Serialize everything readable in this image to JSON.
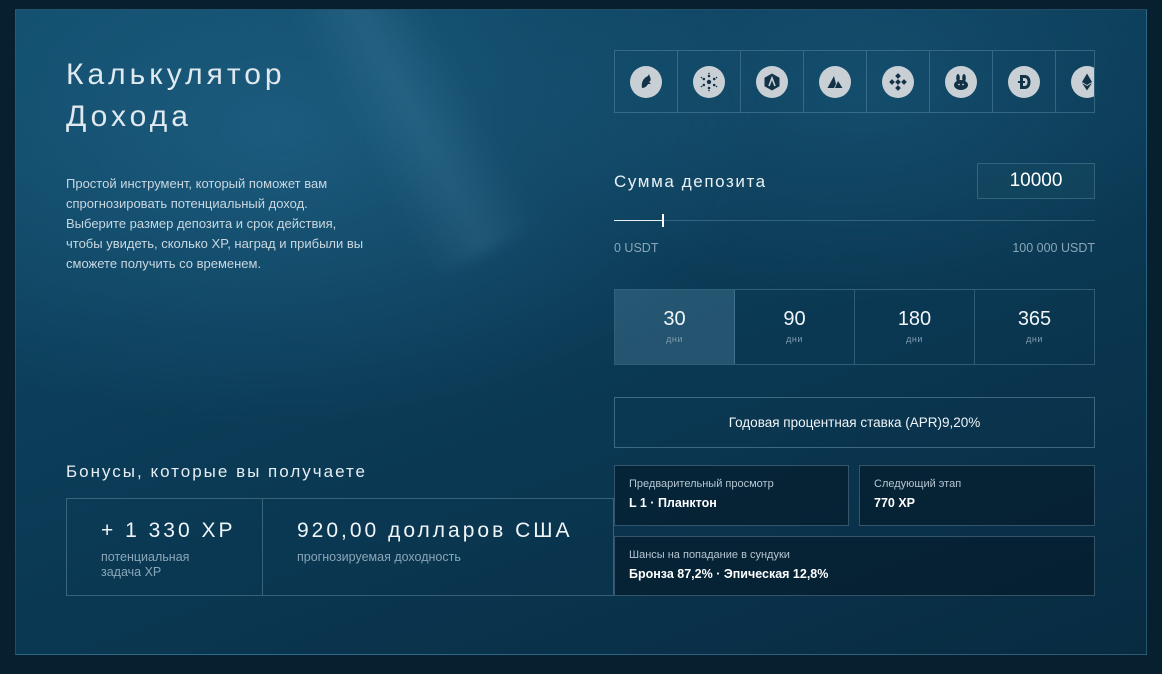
{
  "calculator": {
    "title_line1": "Калькулятор",
    "title_line2": "Дохода",
    "description": "Простой инструмент, который поможет вам спрогнозировать потенциальный доход. Выберите размер депозита и срок действия, чтобы увидеть, сколько XP, наград и прибыли вы сможете получить со временем."
  },
  "coins": [
    {
      "icon": "unicorn-coin-icon"
    },
    {
      "icon": "cardano-coin-icon"
    },
    {
      "icon": "arbitrum-coin-icon"
    },
    {
      "icon": "avalanche-coin-icon"
    },
    {
      "icon": "binance-coin-icon"
    },
    {
      "icon": "pancakeswap-coin-icon"
    },
    {
      "icon": "dogecoin-coin-icon"
    },
    {
      "icon": "ethereum-coin-icon"
    }
  ],
  "deposit": {
    "label": "Сумма депозита",
    "value": "10000",
    "min_label": "0 USDT",
    "max_label": "100 000 USDT",
    "min": 0,
    "max": 100000,
    "current": 10000
  },
  "periods": [
    {
      "value": "30",
      "unit": "дни",
      "active": true
    },
    {
      "value": "90",
      "unit": "дни",
      "active": false
    },
    {
      "value": "180",
      "unit": "дни",
      "active": false
    },
    {
      "value": "365",
      "unit": "дни",
      "active": false
    }
  ],
  "apr": {
    "text": "Годовая процентная ставка (APR)9,20%"
  },
  "preview": {
    "label": "Предварительный просмотр",
    "value": "L 1 · Планктон"
  },
  "next_stage": {
    "label": "Следующий этап",
    "value": "770 XP"
  },
  "chests": {
    "label": "Шансы на попадание в сундуки",
    "value": "Бронза 87,2% · Эпическая 12,8%"
  },
  "bonuses": {
    "title": "Бонусы, которые вы получаете",
    "xp_value": "+ 1 330 XP",
    "xp_label": "потенциальная задача XP",
    "profit_value": "920,00 долларов США",
    "profit_label": "прогнозируемая доходность"
  },
  "colors": {
    "background": "#0c3f5b",
    "accent": "#ffffff",
    "muted": "#8aa6b8"
  }
}
